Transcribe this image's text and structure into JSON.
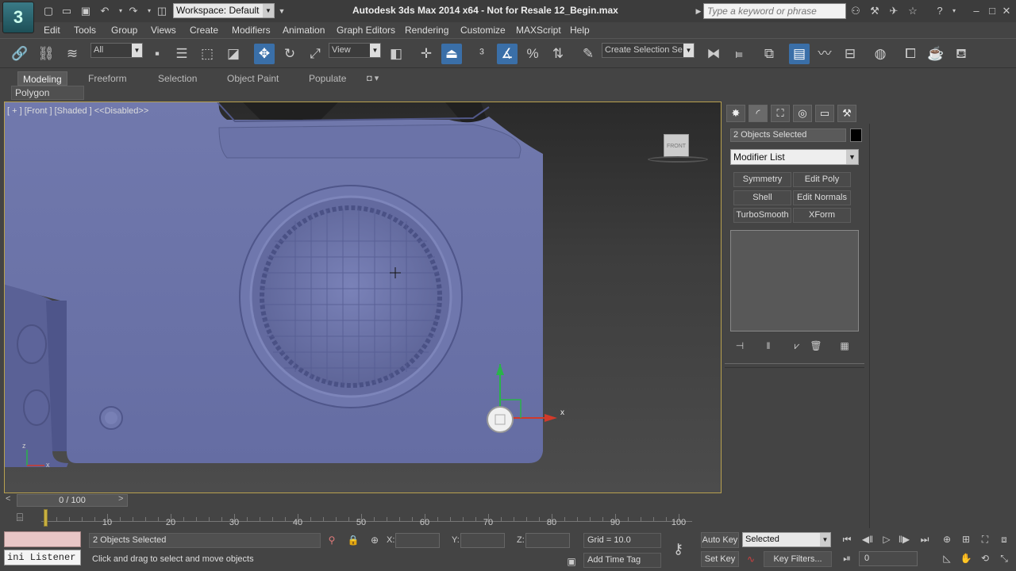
{
  "app": {
    "title": "Autodesk 3ds Max  2014 x64  - Not for Resale   12_Begin.max",
    "logo": "3ds-max-logo",
    "workspace": "Workspace: Default",
    "search_placeholder": "Type a keyword or phrase"
  },
  "menu": [
    "Edit",
    "Tools",
    "Group",
    "Views",
    "Create",
    "Modifiers",
    "Animation",
    "Graph Editors",
    "Rendering",
    "Customize",
    "MAXScript",
    "Help"
  ],
  "toolbar": {
    "selection_filter": "All",
    "reference_coord": "View",
    "named_selection_placeholder": "Create Selection Se"
  },
  "ribbon": {
    "tabs": [
      "Modeling",
      "Freeform",
      "Selection",
      "Object Paint",
      "Populate"
    ],
    "active_tab": "Modeling",
    "panel": "Polygon Modeling"
  },
  "viewport": {
    "label": "[ + ] [Front ] [Shaded ]  <<Disabled>>",
    "navcube_face": "FRONT",
    "gizmo_x_label": "x",
    "axis_z": "z",
    "axis_x": "x"
  },
  "command_panel": {
    "selection_name": "2 Objects Selected",
    "modifier_list": "Modifier List",
    "modifier_buttons": [
      "Symmetry",
      "Edit Poly",
      "Shell",
      "Edit Normals",
      "TurboSmooth",
      "XForm"
    ]
  },
  "timeline": {
    "slider": "0 / 100",
    "prev": "<",
    "next": ">",
    "ticks": [
      "10",
      "20",
      "30",
      "40",
      "50",
      "60",
      "70",
      "80",
      "90",
      "100"
    ]
  },
  "status": {
    "maxscript_listener": "ini Listener",
    "selection_count": "2 Objects Selected",
    "prompt": "Click and drag to select and move objects",
    "x_label": "X:",
    "y_label": "Y:",
    "z_label": "Z:",
    "grid": "Grid = 10.0",
    "add_time_tag": "Add Time Tag",
    "auto_key": "Auto Key",
    "set_key": "Set Key",
    "selected_dropdown": "Selected",
    "key_filters": "Key Filters...",
    "current_frame": "0"
  }
}
